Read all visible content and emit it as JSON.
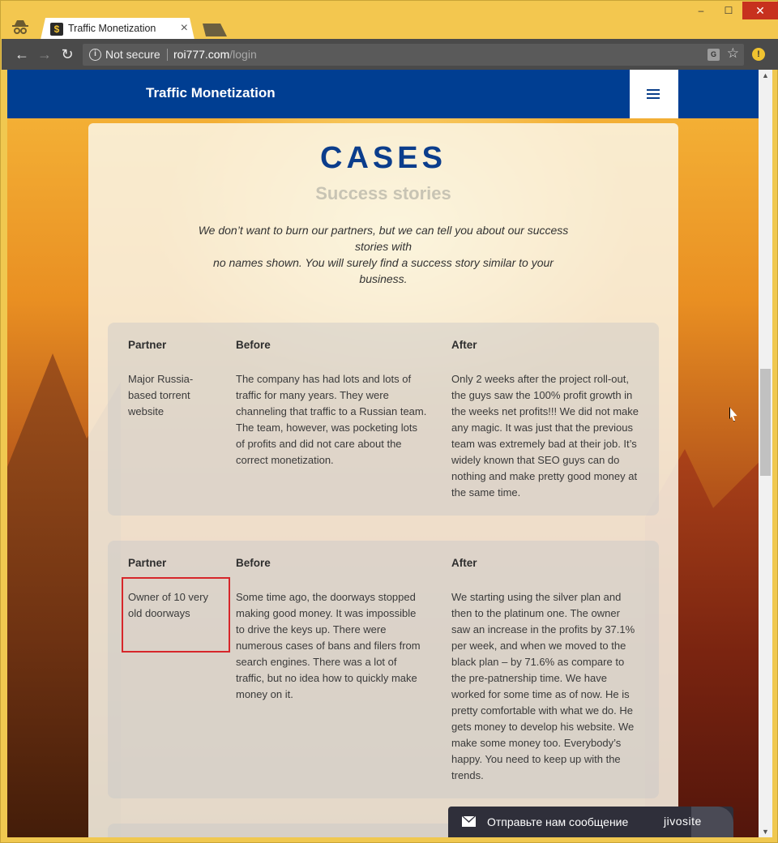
{
  "browser": {
    "tab_title": "Traffic Monetization",
    "tab_favicon": "$",
    "tab_close": "×",
    "security_text": "Not secure",
    "url_host": "roi777.com",
    "url_path": "/login",
    "window_controls": {
      "minimize": "–",
      "maximize": "☐",
      "close": "✕"
    }
  },
  "site": {
    "brand": "Traffic Monetization",
    "title": "CASES",
    "subtitle": "Success stories",
    "intro_line1": "We don’t want to burn our partners, but we can tell you about our success stories with",
    "intro_line2": "no names shown. You will surely find a success story similar to your business.",
    "columns": {
      "partner": "Partner",
      "before": "Before",
      "after": "After"
    },
    "cases": [
      {
        "partner": "Major Russia-based torrent website",
        "before": "The company has had lots and lots of traffic for many years. They were channeling that traffic to a Russian team. The team, however, was pocketing lots of profits and did not care about the correct monetization.",
        "after": "Only 2 weeks after the project roll-out, the guys saw the 100% profit growth in the weeks net profits!!! We did not make any magic. It was just that the previous team was extremely bad at their job. It’s widely known that SEO guys can do nothing and make pretty good money at the same time."
      },
      {
        "partner": "Owner of 10 very old doorways",
        "before": "Some time ago, the doorways stopped making good money. It was impossible to drive the keys up. There were numerous cases of bans and filers from search engines. There was a lot of traffic, but no idea how to quickly make money on it.",
        "after": "We starting using the silver plan and then to the platinum one. The owner saw an increase in the profits by 37.1% per week, and when we moved to the black plan – by 71.6% as compare to the pre-patnership time. We have worked for some time as of now. He is pretty comfortable with what we do. He gets money to develop his website. We make some money too. Everybody’s happy. You need to keep up with the trends."
      }
    ]
  },
  "chat": {
    "message": "Отправьте нам сообщение",
    "logo": "jivosite"
  },
  "colors": {
    "navbar": "#003e92",
    "title": "#0b3d8c",
    "highlight": "#d6262a"
  }
}
